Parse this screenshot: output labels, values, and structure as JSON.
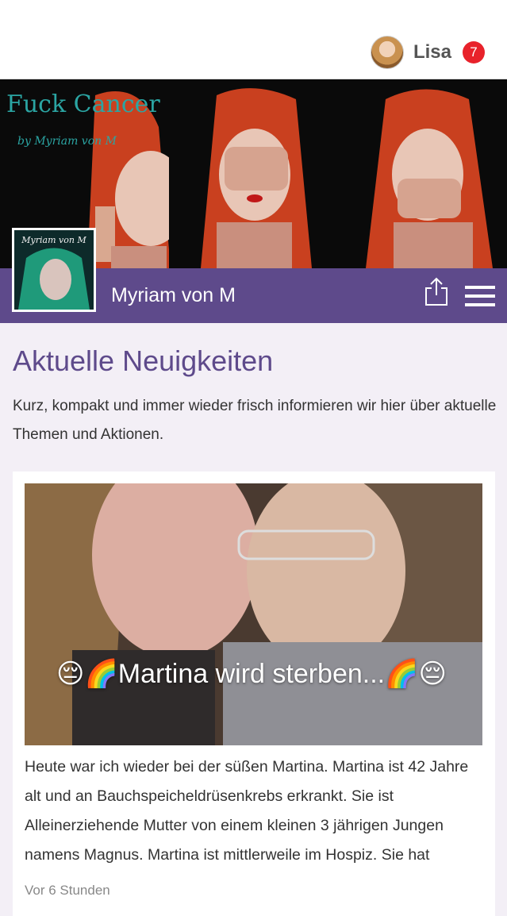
{
  "header": {
    "user_name": "Lisa",
    "notification_count": "7"
  },
  "hero": {
    "title": "Fuck Cancer",
    "subtitle": "by Myriam von M"
  },
  "profile": {
    "thumb_caption": "Myriam von M",
    "name": "Myriam von M"
  },
  "news": {
    "title": "Aktuelle Neuigkeiten",
    "description": "Kurz, kompakt und immer wieder frisch informieren wir hier über aktuelle Themen und Aktionen.",
    "posts": [
      {
        "caption": "😔🌈Martina wird sterben...🌈😔",
        "text": "Heute war ich wieder bei der süßen Martina. Martina ist 42 Jahre alt und an Bauchspeicheldrüsenkrebs erkrankt. Sie ist Alleinerziehende Mutter von einem kleinen 3 jährigen Jungen namens Magnus. Martina ist mittlerweile im Hospiz. Sie hat",
        "time": "Vor 6 Stunden"
      }
    ]
  },
  "colors": {
    "accent": "#5e4a8b",
    "badge": "#e8222b",
    "hero_text": "#2ba5a3"
  },
  "icons": {
    "share": "share-icon",
    "menu": "hamburger-menu-icon"
  }
}
